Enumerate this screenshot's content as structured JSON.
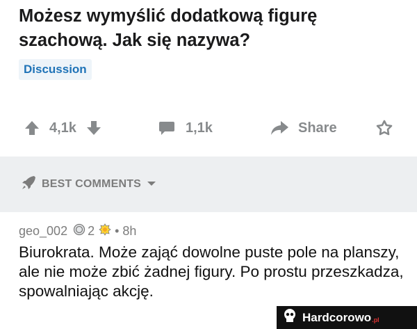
{
  "post": {
    "title": "Możesz wymyślić dodatkową figurę szachową. Jak się nazywa?",
    "flair": "Discussion"
  },
  "actions": {
    "upvotes": "4,1k",
    "comments": "1,1k",
    "share_label": "Share"
  },
  "best_comments": {
    "label": "BEST COMMENTS"
  },
  "comment": {
    "author": "geo_002",
    "award_count": "2",
    "separator": "•",
    "time": "8h",
    "body": "Biurokrata. Może zająć dowolne puste pole na planszy, ale nie może zbić żadnej figury. Po prostu przeszkadza, spowalniając akcję."
  },
  "watermark": {
    "text": "Hardcorowo",
    "tld": ".pl"
  },
  "colors": {
    "flair_text": "#1f73b7",
    "flair_bg": "#eef4f9",
    "action_gray": "#878a8c",
    "band_bg": "#edeff1"
  },
  "icons": [
    "upvote-icon",
    "downvote-icon",
    "comment-icon",
    "share-icon",
    "award-icon",
    "rocket-icon",
    "chevron-down-icon",
    "silver-award-icon",
    "gold-award-icon",
    "skull-icon"
  ]
}
